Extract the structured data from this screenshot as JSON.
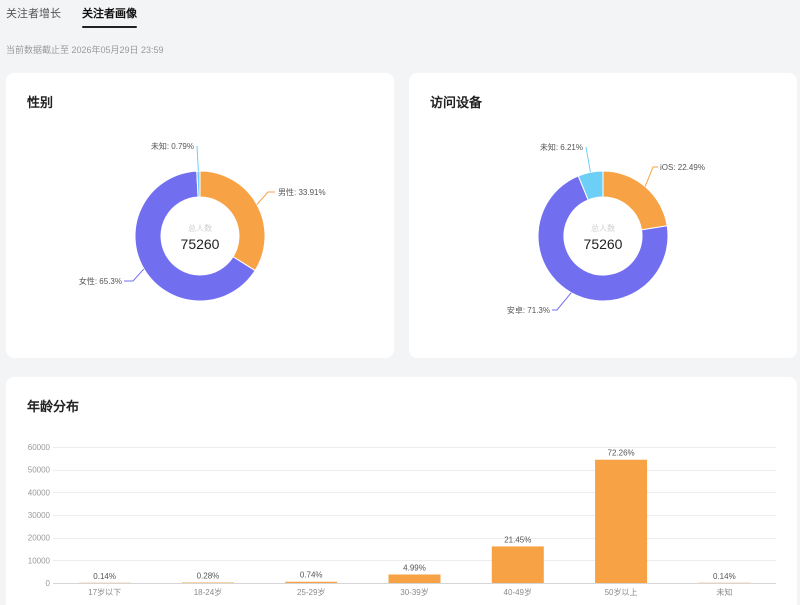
{
  "tabs": [
    {
      "label": "关注者增长",
      "active": false
    },
    {
      "label": "关注者画像",
      "active": true
    }
  ],
  "data_cutoff": "当前数据截止至 2026年05月29日 23:59",
  "chart_data": [
    {
      "type": "pie",
      "title": "性别",
      "center_label": "总人数",
      "center_value": 75260,
      "separator": ": ",
      "unit": "%",
      "slices": [
        {
          "name": "男性",
          "value": 33.91,
          "color": "#F7A244"
        },
        {
          "name": "女性",
          "value": 65.3,
          "color": "#716FF0"
        },
        {
          "name": "未知",
          "value": 0.79,
          "color": "#6ECFF6"
        }
      ]
    },
    {
      "type": "pie",
      "title": "访问设备",
      "center_label": "总人数",
      "center_value": 75260,
      "separator": ": ",
      "unit": "%",
      "slices": [
        {
          "name": "iOS",
          "value": 22.49,
          "color": "#F7A244"
        },
        {
          "name": "安卓",
          "value": 71.3,
          "color": "#716FF0"
        },
        {
          "name": "未知",
          "value": 6.21,
          "color": "#6ECFF6"
        }
      ]
    },
    {
      "type": "bar",
      "title": "年龄分布",
      "categories": [
        "17岁以下",
        "18-24岁",
        "25-29岁",
        "30-39岁",
        "40-49岁",
        "50岁以上",
        "未知"
      ],
      "values": [
        105,
        211,
        557,
        3755,
        16143,
        54383,
        105
      ],
      "data_labels": [
        "0.14%",
        "0.28%",
        "0.74%",
        "4.99%",
        "21.45%",
        "72.26%",
        "0.14%"
      ],
      "yticks": [
        0,
        10000,
        20000,
        30000,
        40000,
        50000,
        60000
      ],
      "ylim": [
        0,
        60000
      ],
      "grid": true,
      "color": "#F7A244"
    }
  ]
}
